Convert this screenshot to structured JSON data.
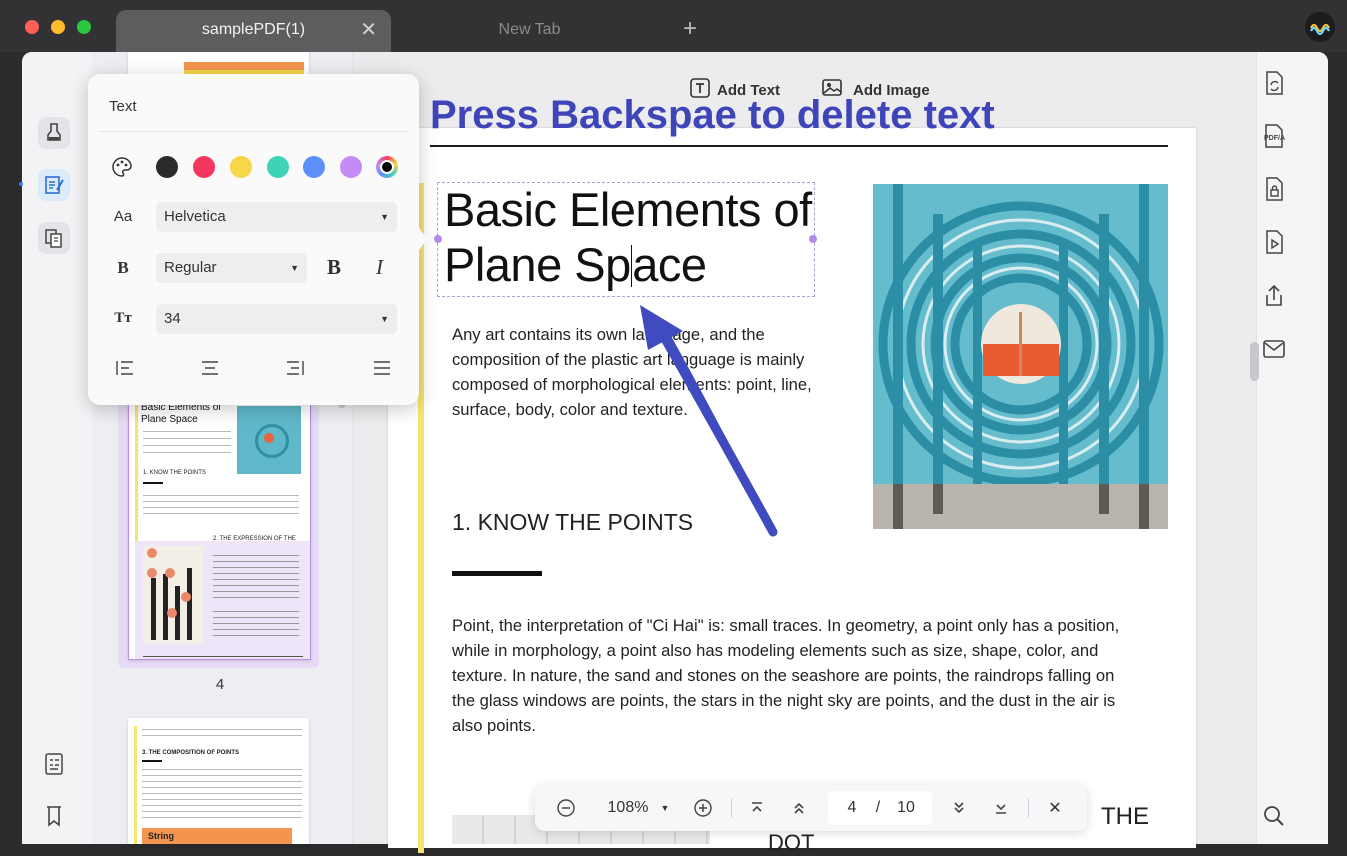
{
  "tabs": [
    {
      "label": "samplePDF(1)",
      "active": true
    },
    {
      "label": "New Tab",
      "active": false
    }
  ],
  "traffic_lights": {
    "close": "#fe5f57",
    "minimize": "#febc2e",
    "zoom": "#28c840"
  },
  "top_tools": {
    "add_text": "Add Text",
    "add_image": "Add Image"
  },
  "annotation": {
    "instruction": "Press Backspae to delete text",
    "color": "#3e45b8",
    "arrow_color": "#3f4bbf"
  },
  "text_popup": {
    "title": "Text",
    "colors": [
      "#2b2b2b",
      "#f2365d",
      "#f7d64a",
      "#3ed2b9",
      "#5b8ff9",
      "#c48cf4",
      "#000000"
    ],
    "font_row_icon": "Aa",
    "font": "Helvetica",
    "weight_row_icon": "B",
    "weight": "Regular",
    "bold_label": "B",
    "italic_label": "I",
    "size_row_icon": "Tт",
    "size": "34"
  },
  "page": {
    "title_line1": "Basic Elements of",
    "title_line2a": "Plane Sp",
    "title_line2b": "ace",
    "intro": [
      "Any art contains its own language, and the",
      "composition of the plastic art language is mainly",
      "composed of morphological elements: point, line,",
      "surface, body, color and texture."
    ],
    "section1": "1. KNOW THE POINTS",
    "para": [
      "Point, the interpretation of \"Ci Hai\" is: small traces. In geometry, a point only has a position,",
      "while in morphology, a point also has modeling elements such as size, shape, color, and",
      "texture. In nature, the sand and stones on the seashore are points, the raindrops falling on",
      "the glass windows are points, the stars in the night sky are points, and the dust in the air is",
      "also points."
    ],
    "bottom_right": "THE",
    "bottom_partial": "DOT"
  },
  "thumbnails": {
    "page4_label": "4",
    "t1_title": "Basic Elements of Plane Space",
    "t1_section": "1. KNOW THE POINTS",
    "t1_section2": "2. THE EXPRESSION OF THE",
    "t2_section": "3. THE COMPOSITION OF POINTS",
    "t2_button": "String"
  },
  "toolbar": {
    "zoom": "108%",
    "page_current": "4",
    "page_sep": "/",
    "page_total": "10"
  }
}
